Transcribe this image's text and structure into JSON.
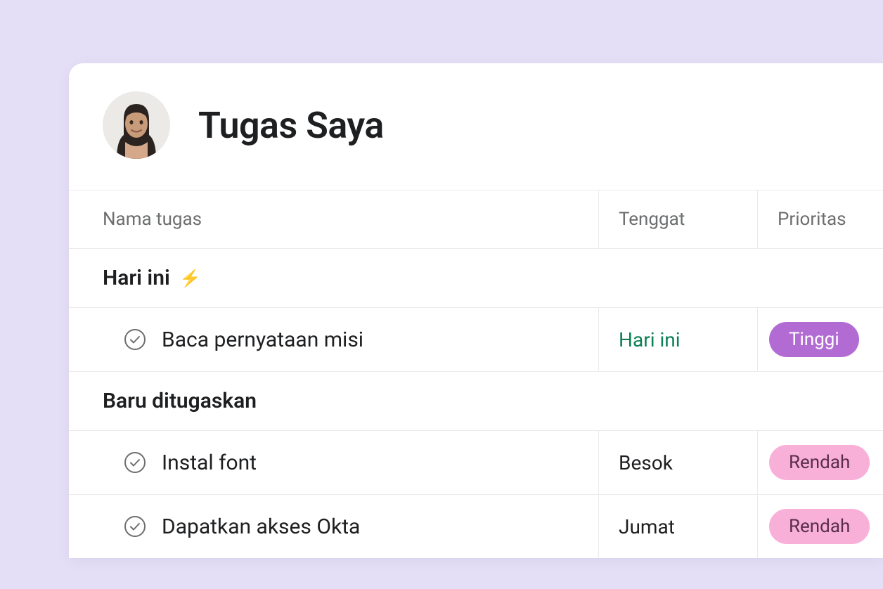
{
  "header": {
    "title": "Tugas Saya"
  },
  "columns": {
    "name": "Nama tugas",
    "deadline": "Tenggat",
    "priority": "Prioritas"
  },
  "sections": [
    {
      "label": "Hari ini",
      "has_bolt": true,
      "tasks": [
        {
          "name": "Baca pernyataan misi",
          "deadline": "Hari ini",
          "deadline_style": "today",
          "priority": "Tinggi",
          "priority_level": "high"
        }
      ]
    },
    {
      "label": "Baru ditugaskan",
      "has_bolt": false,
      "tasks": [
        {
          "name": "Instal font",
          "deadline": "Besok",
          "deadline_style": "normal",
          "priority": "Rendah",
          "priority_level": "low"
        },
        {
          "name": "Dapatkan akses Okta",
          "deadline": "Jumat",
          "deadline_style": "normal",
          "priority": "Rendah",
          "priority_level": "low"
        }
      ]
    }
  ]
}
